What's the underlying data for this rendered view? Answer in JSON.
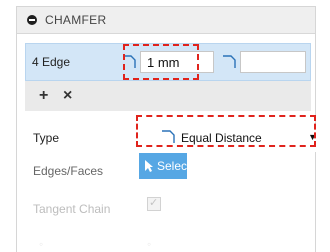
{
  "panel": {
    "title": "CHAMFER",
    "collapse_icon": "collapse-icon"
  },
  "selection": {
    "label": "4 Edge",
    "distance_value": "1 mm",
    "angle_value": "",
    "add_label": "+",
    "remove_label": "×"
  },
  "properties": {
    "type_label": "Type",
    "type_value": "Equal Distance",
    "edges_label": "Edges/Faces",
    "select_button_label": "Select",
    "tangent_label": "Tangent Chain",
    "tangent_checked": true
  },
  "colors": {
    "selection_row_bg": "#d3e6f7",
    "select_button": "#56a7e4",
    "highlight_dash": "#e0231c"
  }
}
